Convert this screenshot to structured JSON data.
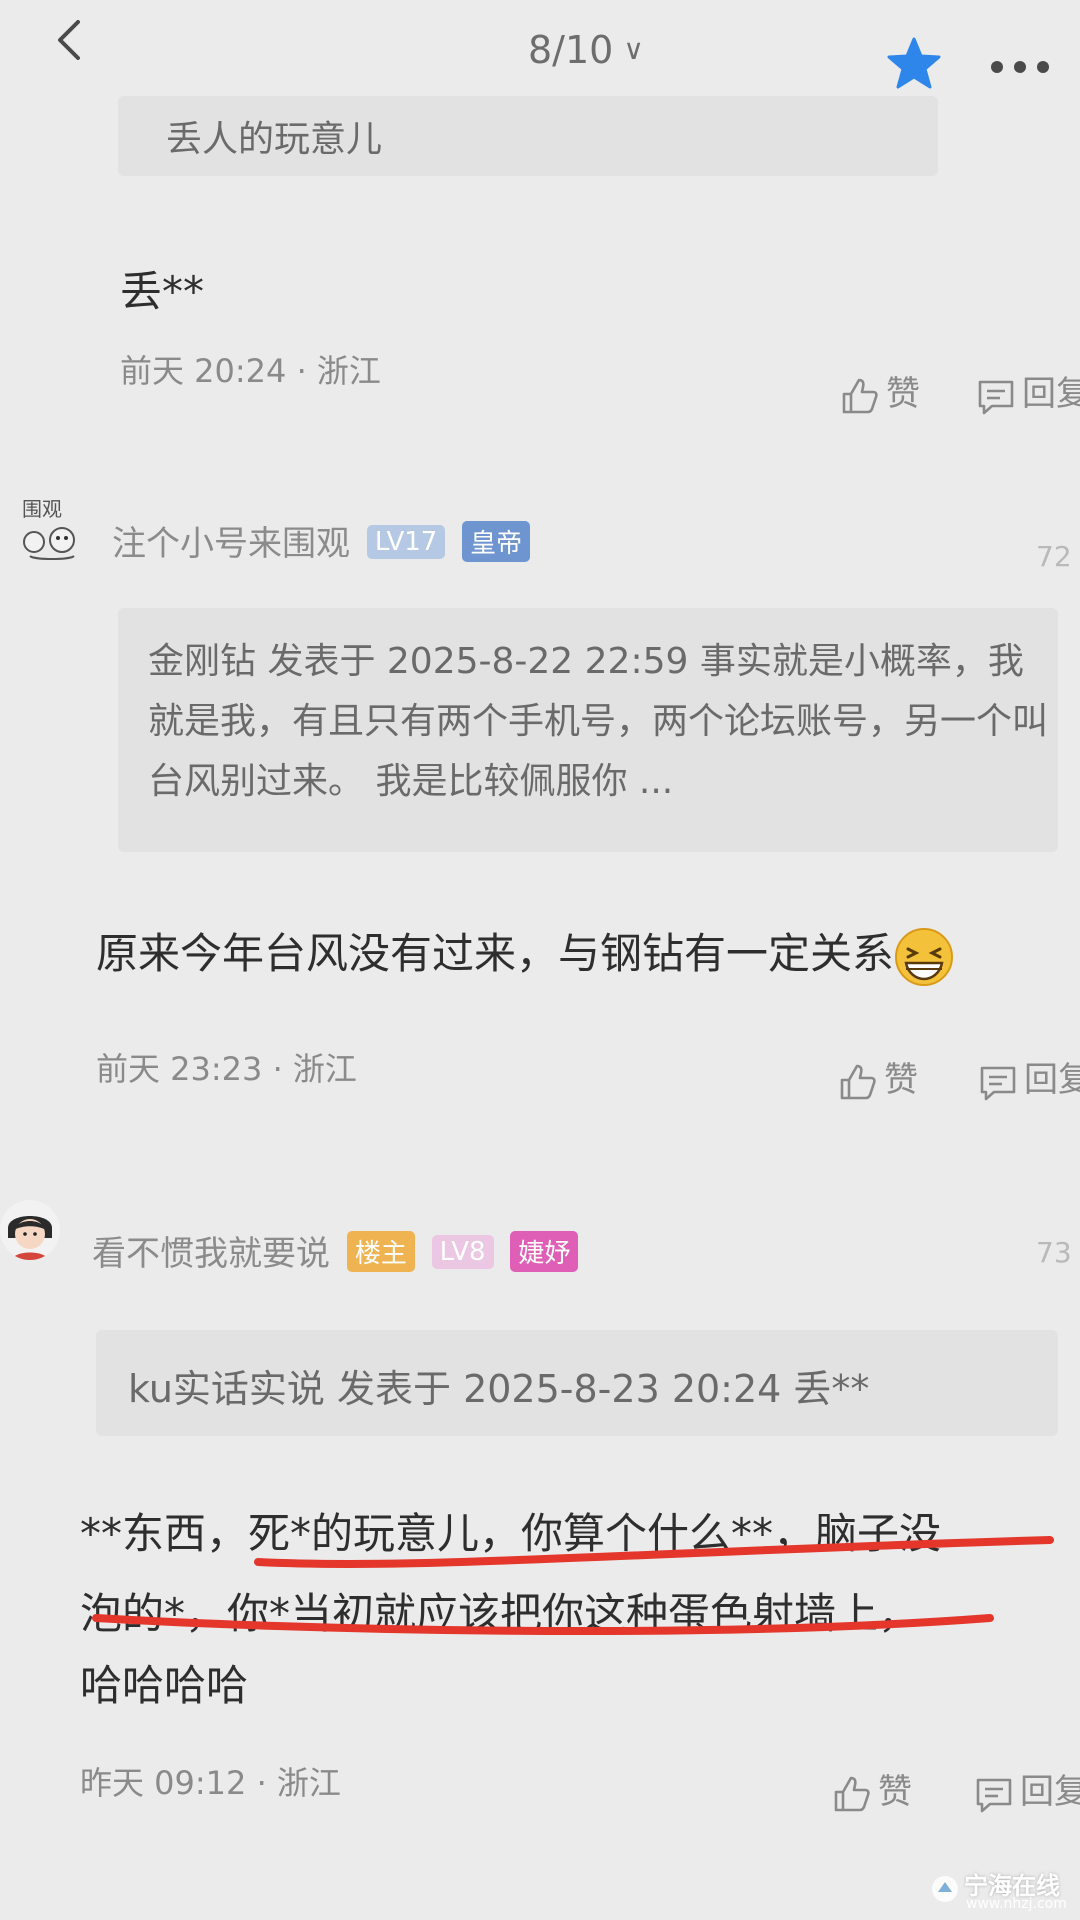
{
  "topbar": {
    "page_indicator": "8/10"
  },
  "comment1": {
    "quote_top": "丢人的玩意儿",
    "body": "丢**",
    "meta": "前天 20:24 · 浙江",
    "like_label": "赞",
    "reply_label": "回复"
  },
  "comment2": {
    "avatar_caption": "围观",
    "username": "注个小号来围观",
    "level_badge": "LV17",
    "title_badge": "皇帝",
    "floor_num": "72",
    "quote": "金刚钻 发表于 2025-8-22 22:59 事实就是小概率，我就是我，有且只有两个手机号，两个论坛账号，另一个叫 台风别过来。 我是比较佩服你 ...",
    "body": "原来今年台风没有过来，与钢钻有一定关系",
    "meta": "前天 23:23 · 浙江",
    "like_label": "赞",
    "reply_label": "回复"
  },
  "comment3": {
    "username": "看不惯我就要说",
    "owner_badge": "楼主",
    "level_badge": "LV8",
    "title_badge": "婕妤",
    "floor_num": "73",
    "quote": "ku实话实说 发表于 2025-8-23 20:24 丢**",
    "body_line1": "**东西，死*的玩意儿，你算个什么**，脑子没",
    "body_line2": "泡的*，你*当初就应该把你这种蛋色射墙上，",
    "body_line3": "哈哈哈哈",
    "meta": "昨天 09:12 · 浙江",
    "like_label": "赞",
    "reply_label": "回复"
  },
  "watermark": {
    "text": "宁海在线",
    "sub": "www.nhzj.com"
  },
  "colors": {
    "background": "#ebebeb",
    "accent_blue": "#2f86ea",
    "underline_red": "#e4362b"
  },
  "icons": [
    "back-icon",
    "chevron-down-icon",
    "star-icon",
    "more-icon",
    "like-icon",
    "reply-icon",
    "grin-emoji-icon"
  ]
}
